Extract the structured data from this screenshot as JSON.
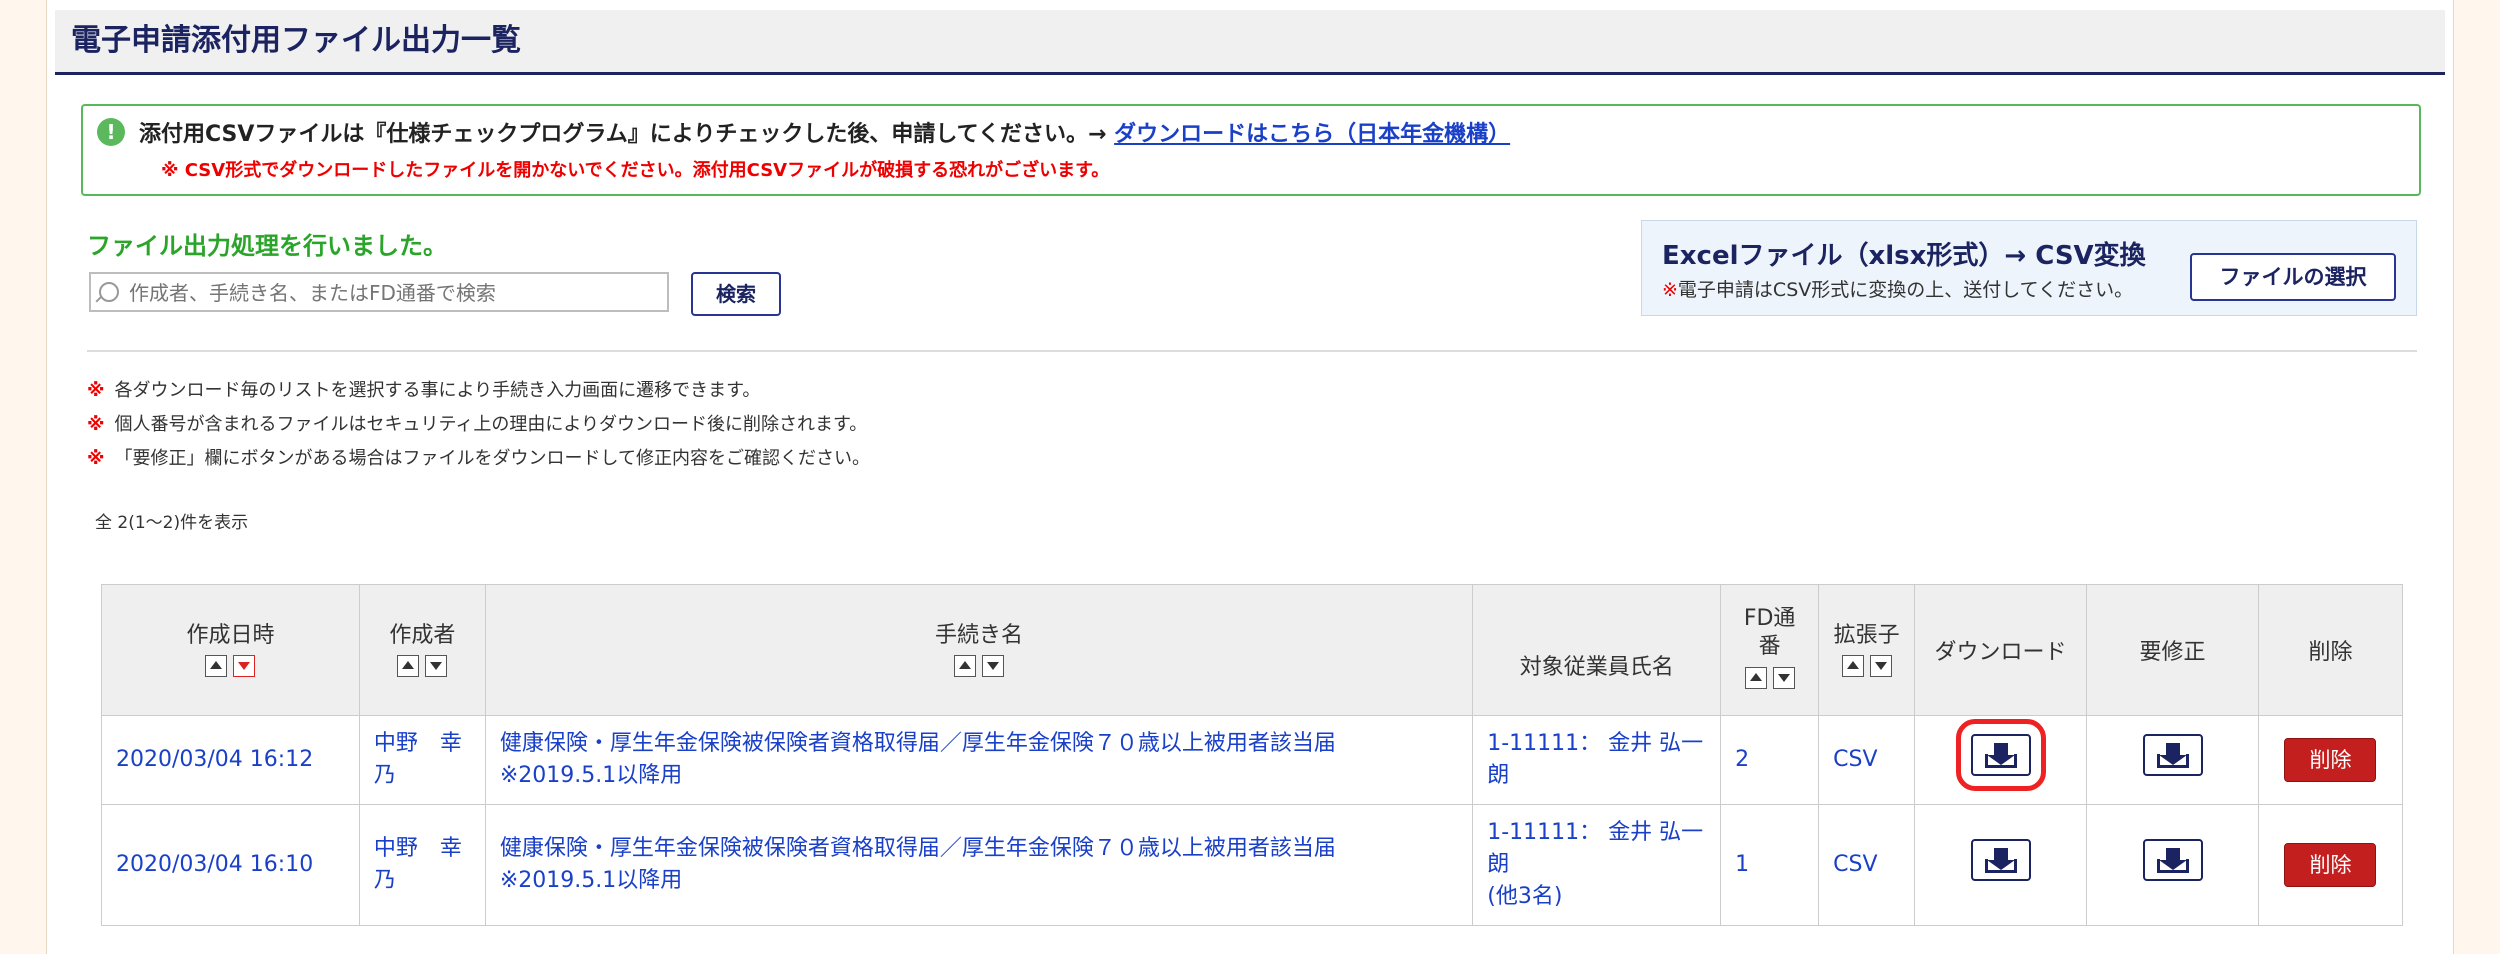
{
  "page": {
    "title": "電子申請添付用ファイル出力一覧"
  },
  "notice": {
    "line1": "添付用CSVファイルは『仕様チェックプログラム』によりチェックした後、申請してください。→",
    "link": "ダウンロードはこちら（日本年金機構）",
    "line2": "※ CSV形式でダウンロードしたファイルを開かないでください。添付用CSVファイルが破損する恐れがございます。"
  },
  "status": {
    "message": "ファイル出力処理を行いました。"
  },
  "search": {
    "placeholder": "作成者、手続き名、またはFD通番で検索",
    "button": "検索"
  },
  "excel": {
    "title": "Excelファイル（xlsx形式）→ CSV変換",
    "note_mark": "※",
    "note": "電子申請はCSV形式に変換の上、送付してください。",
    "button": "ファイルの選択"
  },
  "notes": [
    {
      "mark": "※",
      "text": "各ダウンロード毎のリストを選択する事により手続き入力画面に遷移できます。"
    },
    {
      "mark": "※",
      "text": "個人番号が含まれるファイルはセキュリティ上の理由によりダウンロード後に削除されます。"
    },
    {
      "mark": "※",
      "text": "「要修正」欄にボタンがある場合はファイルをダウンロードして修正内容をご確認ください。"
    }
  ],
  "count": "全 2(1〜2)件を表示",
  "table": {
    "headers": {
      "date": "作成日時",
      "creator": "作成者",
      "procedure": "手続き名",
      "employee": "対象従業員氏名",
      "fd": "FD通番",
      "ext": "拡張子",
      "download": "ダウンロード",
      "fix": "要修正",
      "delete": "削除"
    },
    "rows": [
      {
        "date": "2020/03/04 16:12",
        "creator": "中野　幸乃",
        "procedure": "健康保険・厚生年金保険被保険者資格取得届／厚生年金保険７０歳以上被用者該当届",
        "procedure_sub": "※2019.5.1以降用",
        "employee": "1-11111： 金井 弘一朗",
        "employee_extra": "",
        "fd": "2",
        "ext": "CSV",
        "delete": "削除"
      },
      {
        "date": "2020/03/04 16:10",
        "creator": "中野　幸乃",
        "procedure": "健康保険・厚生年金保険被保険者資格取得届／厚生年金保険７０歳以上被用者該当届",
        "procedure_sub": "※2019.5.1以降用",
        "employee": "1-11111： 金井 弘一朗",
        "employee_extra": "(他3名)",
        "fd": "1",
        "ext": "CSV",
        "delete": "削除"
      }
    ]
  },
  "colors": {
    "brand": "#1b2460",
    "success": "#2aa52a",
    "danger": "#c41f1f",
    "highlight": "#e22222"
  }
}
